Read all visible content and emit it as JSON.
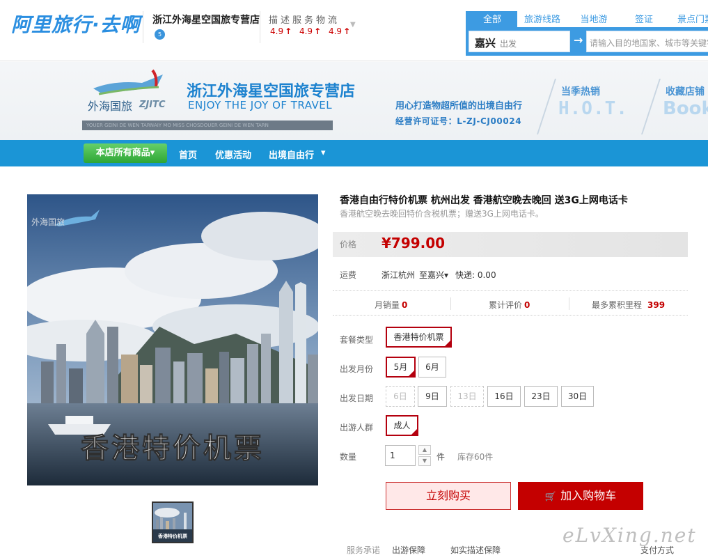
{
  "site": {
    "logo_text": "阿里旅行·去啊",
    "shop_name": "浙江外海星空国旅专营店",
    "shop_badge": "5"
  },
  "rating": {
    "header": "描述服务物流",
    "scores": [
      "4.9",
      "4.9",
      "4.9"
    ],
    "trend_symbol": "↑"
  },
  "search": {
    "tabs": [
      "全部",
      "旅游线路",
      "当地游",
      "签证",
      "景点门票"
    ],
    "active_tab": 0,
    "from_city": "嘉兴",
    "from_label": "出发",
    "swap_symbol": "→",
    "dest_placeholder": "请输入目的地国家、城市等关键字"
  },
  "banner": {
    "logo_zh": "外海国旅",
    "logo_en": "ZJITC",
    "shop_title": "浙江外海星空国旅专营店",
    "enjoy": "ENJOY THE JOY OF TRAVEL",
    "strip_text": "YOUER GEINI DE WEN TARNAIY MO MISS CHOSDOUER GEINI DE WEN TARN",
    "slogan": "用心打造物超所值的出境自由行",
    "license": "经营许可证号：L-ZJ-CJ00024",
    "hot_title": "当季热销",
    "hot_big": "H.O.T.",
    "fav_title": "收藏店铺",
    "fav_big": "Book"
  },
  "nav": {
    "all_products": "本店所有商品▾",
    "links": [
      "首页",
      "优惠活动",
      "出境自由行"
    ],
    "more_caret": "▾"
  },
  "product": {
    "image_logo": "外海国旅",
    "image_text": "香港特价机票",
    "thumb_text": "香港特价机票",
    "title": "香港自由行特价机票 杭州出发 香港航空晚去晚回 送3G上网电话卡",
    "subtitle": "香港航空晚去晚回特价含税机票；赠送3G上网电话卡。",
    "price_label": "价格",
    "price": "¥799.00",
    "shipping": {
      "label": "运费",
      "from": "浙江杭州",
      "to": "至嘉兴▾",
      "fee": "快递: 0.00"
    },
    "stats": [
      {
        "label": "月销量",
        "value": "0"
      },
      {
        "label": "累计评价",
        "value": "0"
      },
      {
        "label": "最多累积里程",
        "value": "399"
      }
    ],
    "options": {
      "package": {
        "label": "套餐类型",
        "values": [
          "香港特价机票"
        ],
        "selected": 0
      },
      "month": {
        "label": "出发月份",
        "values": [
          "5月",
          "6月"
        ],
        "selected": 0
      },
      "date": {
        "label": "出发日期",
        "values": [
          "6日",
          "9日",
          "13日",
          "16日",
          "23日",
          "30日"
        ],
        "disabled": [
          0,
          2
        ]
      },
      "people": {
        "label": "出游人群",
        "values": [
          "成人"
        ],
        "selected": 0
      }
    },
    "quantity": {
      "label": "数量",
      "value": "1",
      "unit": "件",
      "stock": "库存60件",
      "up": "▲",
      "down": "▼"
    },
    "buy_now": "立刻购买",
    "add_cart": "加入购物车",
    "cart_icon": "🛒",
    "promise": {
      "label": "服务承诺",
      "items": [
        "出游保障",
        "如实描述保障"
      ],
      "payment": "支付方式"
    }
  },
  "watermark": "eLvXing.net"
}
